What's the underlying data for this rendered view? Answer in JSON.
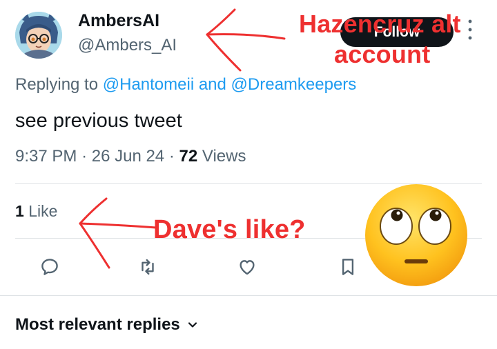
{
  "tweet": {
    "display_name": "AmbersAI",
    "handle": "@Ambers_AI",
    "follow_label": "Follow",
    "reply_prefix": "Replying to",
    "reply_mentions": "@Hantomeii and @Dreamkeepers",
    "text": "see previous tweet",
    "time": "9:37 PM",
    "date": "26 Jun 24",
    "views_count": "72",
    "views_label": "Views",
    "likes_count": "1",
    "likes_label": "Like"
  },
  "actions": [
    {
      "icon": "reply-icon"
    },
    {
      "icon": "retweet-icon"
    },
    {
      "icon": "heart-icon"
    },
    {
      "icon": "bookmark-icon"
    }
  ],
  "replies": {
    "sort_label": "Most relevant replies"
  },
  "annotations": {
    "alt_line1": "Hazencruz alt",
    "alt_line2": "account",
    "dave": "Dave's like?",
    "color": "#ee3030",
    "emoji": "face-with-rolling-eyes"
  },
  "colors": {
    "link": "#1d9bf0",
    "secondary_text": "#536471",
    "primary_text": "#0f1419"
  }
}
